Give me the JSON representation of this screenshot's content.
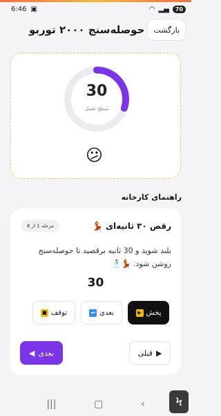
{
  "status_bar": {
    "time": "6:46",
    "battery": "70"
  },
  "header": {
    "title": "حوصله‌سنج ۲۰۰۰ توربو",
    "back_label": "بازگشت"
  },
  "gauge": {
    "value": "30",
    "label": "سطح تحمل",
    "level_percent": 30,
    "accent_color": "#7b35e8",
    "track_color": "#ececf0",
    "emoji": "😕"
  },
  "section": {
    "title": "راهنمای کارخانه"
  },
  "step": {
    "name": "رقص ۳۰ ثانیه‌ای 💃",
    "badge": "مرحله 1 از 6",
    "description": "بلند شوید و 30 ثانیه برقصید تا حوصله‌سنج روشن شود. 💃🕺",
    "counter": "30"
  },
  "controls": {
    "play_label": "پخش",
    "next_label": "بعدی",
    "pause_label": "توقف"
  },
  "navigation": {
    "prev_label": "قبلی",
    "next_label": "بعدی"
  },
  "icons": {
    "play": "play-icon",
    "skip": "skip-next-icon",
    "pause": "pause-icon",
    "prev_arrow": "arrow-right-icon",
    "next_arrow": "arrow-left-icon"
  }
}
